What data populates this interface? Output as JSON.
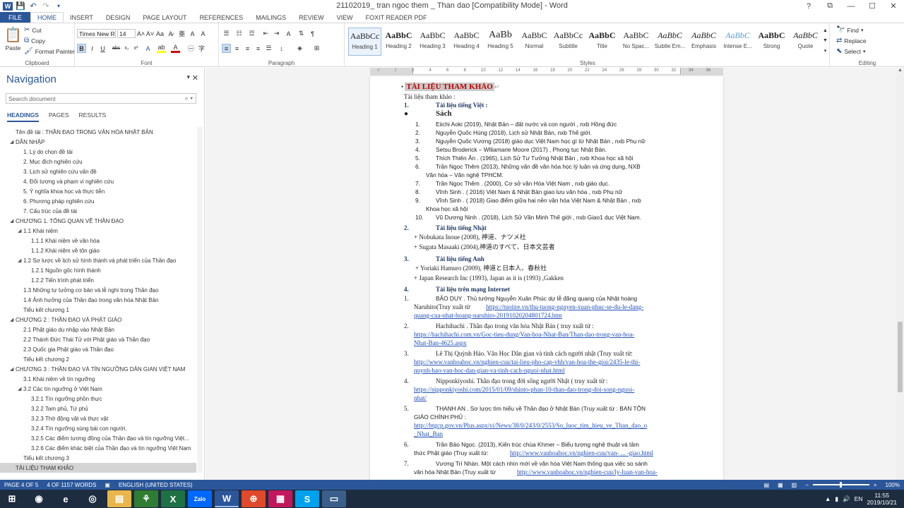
{
  "window": {
    "title": "21102019_ tran ngoc them _ Than dao [Compatibility Mode] - Word",
    "controls": {
      "help": "?",
      "restore": "⧉",
      "minimize": "—",
      "maximize": "☐",
      "close": "✕"
    }
  },
  "ribbon_tabs": [
    "FILE",
    "HOME",
    "INSERT",
    "DESIGN",
    "PAGE LAYOUT",
    "REFERENCES",
    "MAILINGS",
    "REVIEW",
    "VIEW",
    "FOXIT READER PDF"
  ],
  "ribbon": {
    "clipboard": {
      "label": "Clipboard",
      "paste": "Paste",
      "cut": "Cut",
      "copy": "Copy",
      "format_painter": "Format Painter"
    },
    "font": {
      "label": "Font",
      "family": "Times New R",
      "size": "14"
    },
    "paragraph": {
      "label": "Paragraph"
    },
    "styles": {
      "label": "Styles",
      "items": [
        {
          "preview": "AaBbCc",
          "name": "Heading 1"
        },
        {
          "preview": "AaBbC",
          "name": "Heading 2"
        },
        {
          "preview": "AaBbC",
          "name": "Heading 3"
        },
        {
          "preview": "AaBbC",
          "name": "Heading 4"
        },
        {
          "preview": "AaBb",
          "name": "Heading 5"
        },
        {
          "preview": "AaBbC",
          "name": "Normal"
        },
        {
          "preview": "AaBbCc",
          "name": "Subtitle"
        },
        {
          "preview": "AaBbC",
          "name": "Title"
        },
        {
          "preview": "AaBbC",
          "name": "No Spac..."
        },
        {
          "preview": "AaBbC",
          "name": "Subtle Em..."
        },
        {
          "preview": "AaBbC",
          "name": "Emphasis"
        },
        {
          "preview": "AaBbC",
          "name": "Intense E..."
        },
        {
          "preview": "AaBbC",
          "name": "Strong"
        },
        {
          "preview": "AaBbC",
          "name": "Quote"
        }
      ]
    },
    "editing": {
      "label": "Editing",
      "find": "Find",
      "replace": "Replace",
      "select": "Select"
    }
  },
  "nav": {
    "title": "Navigation",
    "search_placeholder": "Search document",
    "tabs": [
      "HEADINGS",
      "PAGES",
      "RESULTS"
    ],
    "items": [
      {
        "text": "Tên đề tài : THẦN ĐẠO TRONG VĂN HÓA NHẬT BẢN",
        "level": 0,
        "arrow": ""
      },
      {
        "text": "DẪN NHẬP",
        "level": 0,
        "arrow": "◢"
      },
      {
        "text": "1. Lý do chọn đề tài",
        "level": 1,
        "arrow": ""
      },
      {
        "text": "2. Mục đích nghiên cứu",
        "level": 1,
        "arrow": ""
      },
      {
        "text": "3. Lịch sử nghiên cứu vấn đề",
        "level": 1,
        "arrow": ""
      },
      {
        "text": "4. Đối tượng và phạm vi nghiên cứu",
        "level": 1,
        "arrow": ""
      },
      {
        "text": "5. Ý nghĩa khoa học và thực tiễn",
        "level": 1,
        "arrow": ""
      },
      {
        "text": "6. Phương pháp nghiên cứu",
        "level": 1,
        "arrow": ""
      },
      {
        "text": "7. Cấu trúc của đề tài",
        "level": 1,
        "arrow": ""
      },
      {
        "text": "CHƯƠNG 1. TỔNG QUAN VỀ THẦN ĐẠO",
        "level": 0,
        "arrow": "◢"
      },
      {
        "text": "1.1 Khái niệm",
        "level": 1,
        "arrow": "◢"
      },
      {
        "text": "1.1.1 Khái niệm về văn hóa",
        "level": 2,
        "arrow": ""
      },
      {
        "text": "1.1.2 Khái niệm về tôn giáo",
        "level": 2,
        "arrow": ""
      },
      {
        "text": "1.2 Sơ lược về lịch sử hình thành và phát triển của Thần đạo",
        "level": 1,
        "arrow": "◢"
      },
      {
        "text": "1.2.1 Nguồn gốc hình thành",
        "level": 2,
        "arrow": ""
      },
      {
        "text": "1.2.2 Tiến trình phát triển",
        "level": 2,
        "arrow": ""
      },
      {
        "text": "1.3 Những tư tưởng cơ bản và lễ nghi trong Thần đạo",
        "level": 1,
        "arrow": ""
      },
      {
        "text": "1.4  Ảnh hưởng của Thần đạo trong văn hóa Nhật Bản",
        "level": 1,
        "arrow": ""
      },
      {
        "text": "Tiểu kết chương 1",
        "level": 1,
        "arrow": ""
      },
      {
        "text": "CHƯƠNG 2 :  THẦN ĐẠO VÀ PHẬT GIÁO",
        "level": 0,
        "arrow": "◢"
      },
      {
        "text": "2.1 Phật giáo du nhập vào Nhật Bản",
        "level": 1,
        "arrow": ""
      },
      {
        "text": "2.2 Thánh Đức Thái Tử với Phật giáo và Thần đạo",
        "level": 1,
        "arrow": ""
      },
      {
        "text": "2.3 Quốc gia Phật giáo và Thần đạo",
        "level": 1,
        "arrow": ""
      },
      {
        "text": "Tiểu kết chương 2",
        "level": 1,
        "arrow": ""
      },
      {
        "text": "CHƯƠNG 3 : THẦN ĐẠO VÀ TÍN NGƯỠNG DÂN GIAN VIỆT NAM",
        "level": 0,
        "arrow": "◢"
      },
      {
        "text": "3.1 Khái niệm về tín ngưỡng",
        "level": 1,
        "arrow": ""
      },
      {
        "text": "3.2 Các tín ngưỡng ở Việt Nam",
        "level": 1,
        "arrow": "◢"
      },
      {
        "text": "3.2.1 Tín ngưỡng phồn thực",
        "level": 2,
        "arrow": ""
      },
      {
        "text": "3.2.2 Tam phủ, Tứ phủ",
        "level": 2,
        "arrow": ""
      },
      {
        "text": "3.2.3 Thờ động vật và thực vật",
        "level": 2,
        "arrow": ""
      },
      {
        "text": "3.2.4 Tín ngưỡng sùng bái con người.",
        "level": 2,
        "arrow": ""
      },
      {
        "text": "3.2.5 Các điểm tương đồng của Thần đạo và tín ngưỡng Việt...",
        "level": 2,
        "arrow": ""
      },
      {
        "text": "3.2.6 Các điểm khác biệt của Thần đạo và tín ngưỡng Việt Nam",
        "level": 2,
        "arrow": ""
      },
      {
        "text": "Tiểu kết chương 3",
        "level": 1,
        "arrow": ""
      },
      {
        "text": "TÀI LIỆU THAM KHẢO",
        "level": 0,
        "arrow": "",
        "selected": true
      }
    ]
  },
  "ruler": [
    "4",
    "2",
    "2",
    "4",
    "6",
    "8",
    "10",
    "12",
    "14",
    "16",
    "18",
    "20",
    "22",
    "24",
    "26",
    "28",
    "30",
    "32",
    "34",
    "36"
  ],
  "doc": {
    "heading": "TÀI LIỆU THAM KHẢO",
    "intro": "Tài  liệu tham khảo :",
    "s1_num": "1.",
    "s1_title": "Tài liệu tiếng Việt :",
    "books_title": "Sách",
    "books": [
      {
        "n": "1.",
        "t": "Eiichi Aoki (2019), Nhật Bản – đất nước và con người , nxb Hồng đức"
      },
      {
        "n": "2.",
        "t": "Nguyễn Quốc Hùng (2018), Lịch sử Nhật Bản, nxb Thế giới."
      },
      {
        "n": "3.",
        "t": "Nguyễn Quốc Vương (2018) giáo dục Việt Nam học gì từ Nhật Bản , nxb Phụ nữ"
      },
      {
        "n": "4.",
        "t": "Setsu Broderick – Wlliamarie Moore (2017) , Phong tục Nhật Bản."
      },
      {
        "n": "5.",
        "t": "Thích Thiên Ân . (1965), Lịch Sử Tư Tưởng Nhật Bản , nxb Khoa học xã hội"
      },
      {
        "n": "6.",
        "t": "Trần Ngọc Thêm (2013), Những vấn đề văn hóa học lý luận và ứng dụng, NXB",
        "t2": "Văn hóa – Văn nghệ TPHCM."
      },
      {
        "n": "7.",
        "t": "Trần Ngọc Thêm . (2000), Cơ sở văn Hóa Việt Nam ,  nxb giáo dục."
      },
      {
        "n": "8.",
        "t": "Vĩnh Sinh . ( 2016) Việt Nam & Nhật Bản giao lưu văn hóa , nxb Phụ nữ"
      },
      {
        "n": "9.",
        "t": "Vĩnh Sinh . ( 2018)  Giao điểm giữa hai nền văn hóa Việt Nam & Nhật Bản , nxb",
        "t2": "Khoa học xã hội"
      },
      {
        "n": "10.",
        "t": "Vũ Dương Ninh . (2018), Lịch Sử Văn Minh Thế giới , nxb Giao1 dục Việt Nam."
      }
    ],
    "s2_num": "2.",
    "s2_title": "Tài liệu tiếng Nhật",
    "jp": [
      "+ Nobukata Inoue (2008), 神道、ナツメ社",
      "+ Sugata Masaaki (2004),神道のすべて、日本文芸者"
    ],
    "s3_num": "3.",
    "s3_title": "Tài liệu tiếng Anh",
    "en": [
      "+ Yoriaki Hamuro (2009), 神道と日本人、春秋社",
      "+ Japan Research Inc (1993), Japan as it is (1993) ,Gakken"
    ],
    "s4_num": "4.",
    "s4_title": "Tài liệu trên mạng Internet",
    "web": [
      {
        "n": "1.",
        "a": "BẢO DUY . Thủ tướng Nguyễn Xuân Phúc dự lễ đăng quang của Nhật hoàng",
        "b": "Naruhito(Truy xuất từ  ",
        "link": "https://tuoitre.vn/thu-tuong-nguyen-xuan-phuc-se-du-le-dang-",
        "link2": "quang-cua-nhat-hoang-naruhito-20191020204801724.htm"
      },
      {
        "n": "2.",
        "a": "Hachihachi . Thần đạo trong văn hóa Nhật Bản ( truy xuất từ :",
        "link": "https://hachihachi.com.vn/Goc-tieu-dung/Van-hoa-Nhat-Ban/Than-dao-trong-van-hoa-",
        "link2": "Nhat-Ban-4625.aspx"
      },
      {
        "n": "3.",
        "a": "Lê Thị Quỳnh Hảo. Văn Học Dân gian và tính cách người nhật (Truy xuất từ:",
        "link": "http://www.vanhoahoc.vn/nghien-cuu/tai-lieu-pho-cap-vhh/van-hoa-the-gioi/2435-le-thi-",
        "link2": "quynh-hao-van-hoc-dan-gian-va-tinh-cach-nguoi-nhat.html"
      },
      {
        "n": "4.",
        "a": " Nipponkiyoshi. Thần đạo trong đời sống người Nhật ( truy xuất từ :",
        "link": "https://nipponkiyoshi.com/2015/01/09/shinto-phan-10-than-dao-trong-doi-song-nguoi-",
        "link2": "nhat/"
      },
      {
        "n": "5.",
        "a": "THANH AN . Sơ lược tìm hiểu về Thần đạo ở Nhật Bản (Truy xuất từ : BAN TÔN",
        "b": "GIÁO CHÍNH PHỦ :",
        "link": "http://btgcp.gov.vn/Plus.aspx/vi/News/38/0/243/0/2553/So_luoc_tim_hieu_ve_Than_dao_o",
        "link2": "_Nhat_Ban"
      },
      {
        "n": "6.",
        "a": "Trần Bảo Ngọc. (2013), Kiến trúc chùa Khmer – Biểu tượng nghệ thuật và tâm",
        "b": "thức Phật giáo (Truy xuất từ: ",
        "link": "http://www.vanhoahoc.vn/nghien-cuu/van-  ...  -giao.html"
      },
      {
        "n": "7.",
        "a": "Vương Trí Nhàn. Một cách nhìn mới về văn hóa Việt Nam thông qua việc so sánh",
        "b": "văn hóa Nhật Bản (Truy xuất từ ",
        "link": "http://www.vanhoahoc.vn/nghien-cuu/ly-luan-van-hoa-"
      }
    ]
  },
  "status": {
    "page": "PAGE 4 OF 5",
    "words": "4 OF 1157 WORDS",
    "lang": "ENGLISH (UNITED STATES)",
    "zoom": "100%"
  },
  "taskbar": {
    "apps": [
      "⊞",
      "◉",
      "e",
      "◎",
      "▤",
      "⚘",
      "X",
      "Zalo",
      "W",
      "⊕",
      "▦",
      "S",
      "▭"
    ],
    "tray": {
      "lang": "EN",
      "time": "11:55",
      "date": "2019/10/21"
    }
  },
  "colors": {
    "word_blue": "#2b579a",
    "heading_red": "#c00000",
    "link_blue": "#1f4fb8",
    "navy": "#1f3864"
  }
}
